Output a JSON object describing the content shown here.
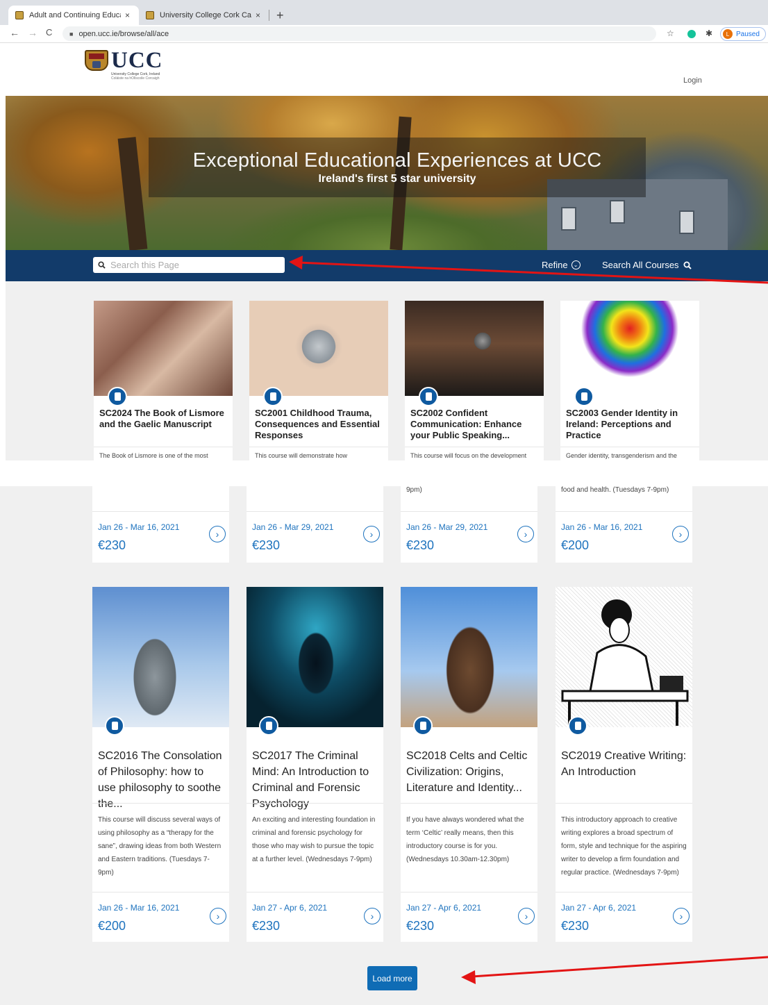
{
  "browser": {
    "tabs": [
      {
        "title": "Adult and Continuing Educatio",
        "close": "×",
        "active": true
      },
      {
        "title": "University College Cork Catalo",
        "close": "×",
        "active": false
      }
    ],
    "new_tab": "+",
    "back": "←",
    "forward": "→",
    "reload": "C",
    "url": "open.ucc.ie/browse/all/ace",
    "profile_initial": "L",
    "profile_status": "Paused"
  },
  "site": {
    "logo_text": "UCC",
    "logo_sub1": "University College Cork, Ireland",
    "logo_sub2": "Coláiste na hOllscoile Corcaigh",
    "login": "Login"
  },
  "hero": {
    "title": "Exceptional Educational Experiences at UCC",
    "subtitle": "Ireland's first 5 star university"
  },
  "search": {
    "placeholder": "Search this Page",
    "refine": "Refine",
    "search_all": "Search All Courses"
  },
  "top_courses": [
    {
      "title": "SC2024 The Book of Lismore and the Gaelic Manuscript",
      "desc": "The Book of Lismore is one of the most"
    },
    {
      "title": "SC2001 Childhood Trauma, Consequences and Essential Responses",
      "desc": "This course will demonstrate how"
    },
    {
      "title": "SC2002 Confident Communication: Enhance your Public Speaking...",
      "desc": "This course will focus on the development"
    },
    {
      "title": "SC2003 Gender Identity in Ireland: Perceptions and Practice",
      "desc": "Gender identity, transgenderism and the"
    }
  ],
  "mid_courses": [
    {
      "desc_tail": "",
      "dates": "Jan 26 - Mar 16, 2021",
      "price": "€230"
    },
    {
      "desc_tail": "",
      "dates": "Jan 26 - Mar 29, 2021",
      "price": "€230"
    },
    {
      "desc_tail": "9pm)",
      "dates": "Jan 26 - Mar 29, 2021",
      "price": "€230"
    },
    {
      "desc_tail": "food and health. (Tuesdays 7-9pm)",
      "dates": "Jan 26 - Mar 16, 2021",
      "price": "€200"
    }
  ],
  "bottom_courses": [
    {
      "title": "SC2016 The Consolation of Philosophy: how to use philosophy to soothe the...",
      "desc": "This course will discuss several ways of using philosophy as a “therapy for the sane”, drawing ideas from both Western and Eastern traditions. (Tuesdays 7-9pm)",
      "dates": "Jan 26 - Mar 16, 2021",
      "price": "€200"
    },
    {
      "title": "SC2017 The Criminal Mind: An Introduction to Criminal and Forensic Psychology",
      "desc": "An exciting and interesting foundation in criminal and forensic psychology for those who may wish to pursue the topic at a further level. (Wednesdays 7-9pm)",
      "dates": "Jan 27 - Apr 6, 2021",
      "price": "€230"
    },
    {
      "title": "SC2018 Celts and Celtic Civilization: Origins, Literature and Identity...",
      "desc": "If you have always wondered what the term ‘Celtic’ really means, then this introductory course is for you. (Wednesdays 10.30am-12.30pm)",
      "dates": "Jan 27 - Apr 6, 2021",
      "price": "€230"
    },
    {
      "title": "SC2019 Creative Writing: An Introduction",
      "desc": "This introductory approach to creative writing explores a broad spectrum of form, style and technique for the aspiring writer to develop a firm foundation and regular practice. (Wednesdays 7-9pm)",
      "dates": "Jan 27 - Apr 6, 2021",
      "price": "€230"
    }
  ],
  "load_more": "Load more",
  "colors": {
    "brand_navy": "#123b6a",
    "link_blue": "#1e73be",
    "button_blue": "#0f6cb5",
    "annotation_red": "#e31414"
  },
  "icons": [
    "search-icon",
    "chevron-down-circle-icon",
    "arrow-right-circle-icon",
    "course-type-icon",
    "lock-icon",
    "star-icon",
    "extension-icon",
    "grammarly-icon"
  ]
}
